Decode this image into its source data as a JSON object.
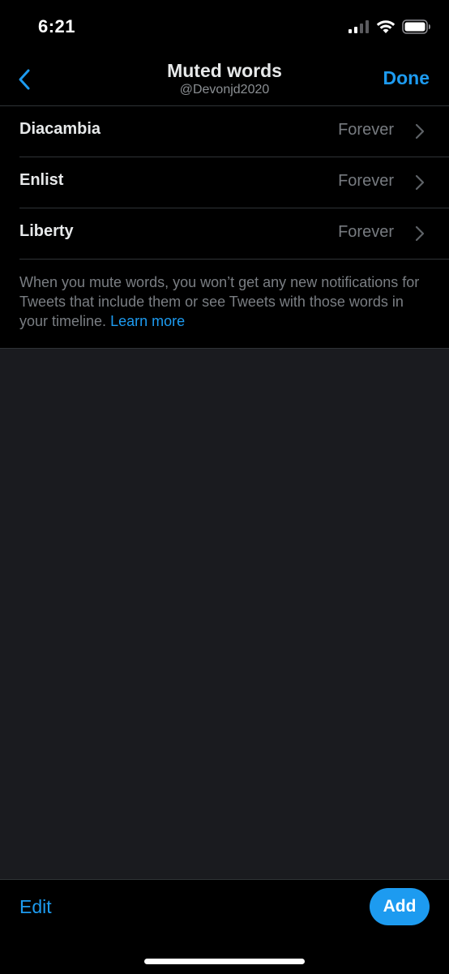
{
  "status_bar": {
    "time": "6:21",
    "icons": [
      "signal-icon",
      "wifi-icon",
      "battery-icon"
    ]
  },
  "header": {
    "title": "Muted words",
    "subtitle": "@Devonjd2020",
    "back_icon": "chevron-left-icon",
    "done_label": "Done"
  },
  "muted_words": [
    {
      "word": "Diacambia",
      "duration": "Forever"
    },
    {
      "word": "Enlist",
      "duration": "Forever"
    },
    {
      "word": "Liberty",
      "duration": "Forever"
    }
  ],
  "info": {
    "text": "When you mute words, you won’t get any new notifications for Tweets that include them or see Tweets with those words in your timeline.",
    "link_label": "Learn more"
  },
  "toolbar": {
    "edit_label": "Edit",
    "add_label": "Add"
  },
  "colors": {
    "accent": "#1d9bf0",
    "background": "#000000",
    "empty_area": "#1a1b1f",
    "divider": "#2f3336",
    "secondary_text": "#7a7e83"
  }
}
